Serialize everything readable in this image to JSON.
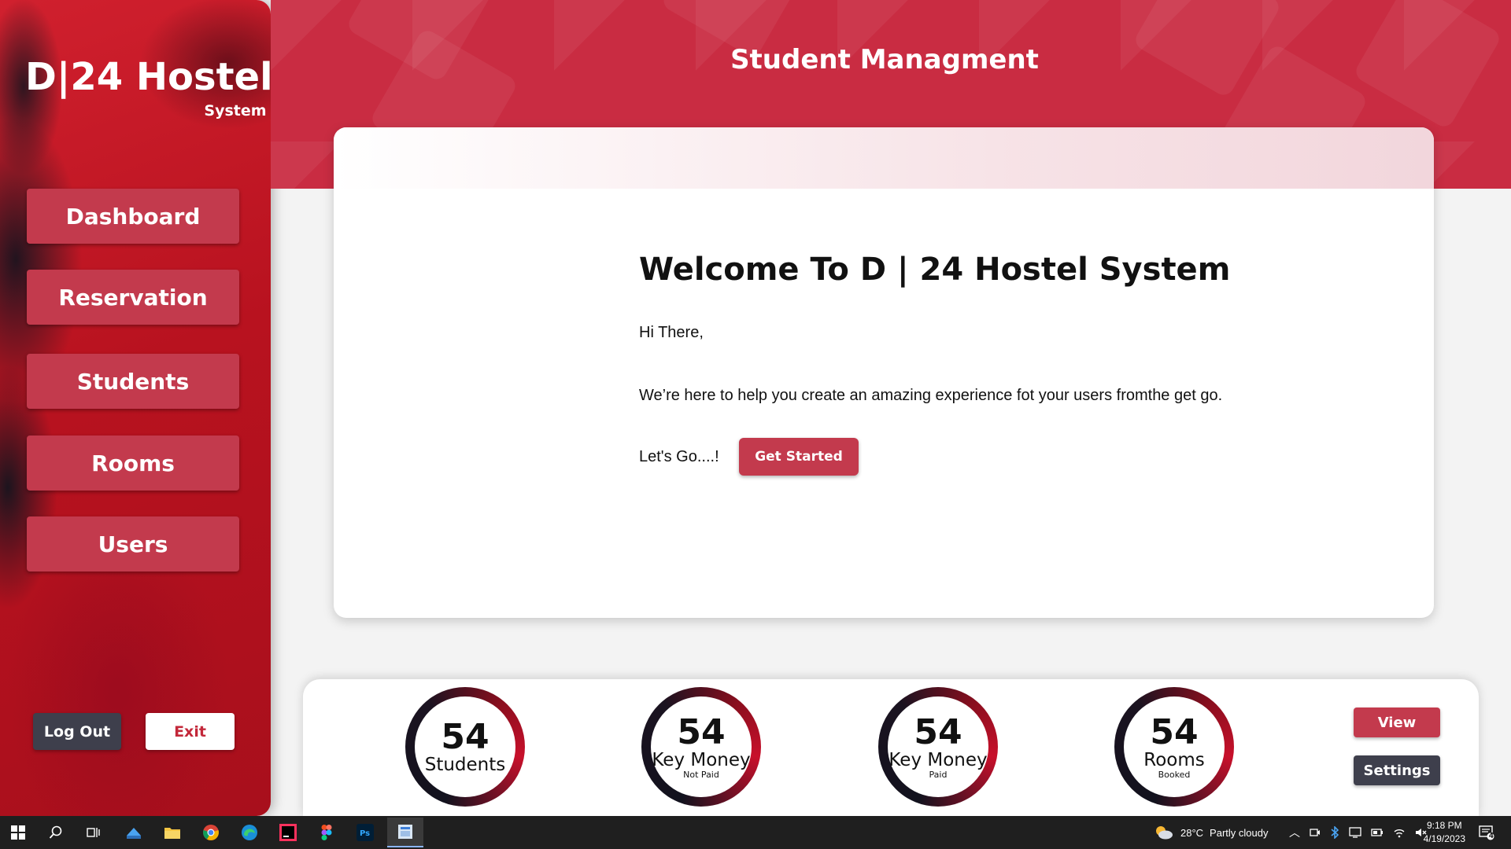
{
  "sidebar": {
    "brand_title": "D|24 Hostel",
    "brand_sub": "System",
    "nav": [
      {
        "label": "Dashboard"
      },
      {
        "label": "Reservation"
      },
      {
        "label": "Students"
      },
      {
        "label": "Rooms"
      },
      {
        "label": "Users"
      }
    ],
    "logout_label": "Log Out",
    "exit_label": "Exit"
  },
  "header": {
    "title": "Student Managment"
  },
  "main": {
    "welcome_title": "Welcome To D | 24 Hostel System",
    "greeting": "Hi There,",
    "intro": "We’re here to  help  you create an amazing experience fot your users fromthe get go.",
    "lets_go": "Let's Go....!",
    "get_started_label": "Get Started"
  },
  "stats": [
    {
      "value": "54",
      "label": "Students",
      "sub": ""
    },
    {
      "value": "54",
      "label": "Key Money",
      "sub": "Not Paid"
    },
    {
      "value": "54",
      "label": "Key Money",
      "sub": "Paid"
    },
    {
      "value": "54",
      "label": "Rooms",
      "sub": "Booked"
    }
  ],
  "actions": {
    "view_label": "View",
    "settings_label": "Settings"
  },
  "taskbar": {
    "weather": "28°C",
    "weather_desc": "Partly cloudy",
    "time": "9:18 PM",
    "date": "4/19/2023",
    "notification_count": "4"
  },
  "colors": {
    "accent": "#c33a4d",
    "header": "#c92c42",
    "dark_button": "#3e3f4c"
  }
}
